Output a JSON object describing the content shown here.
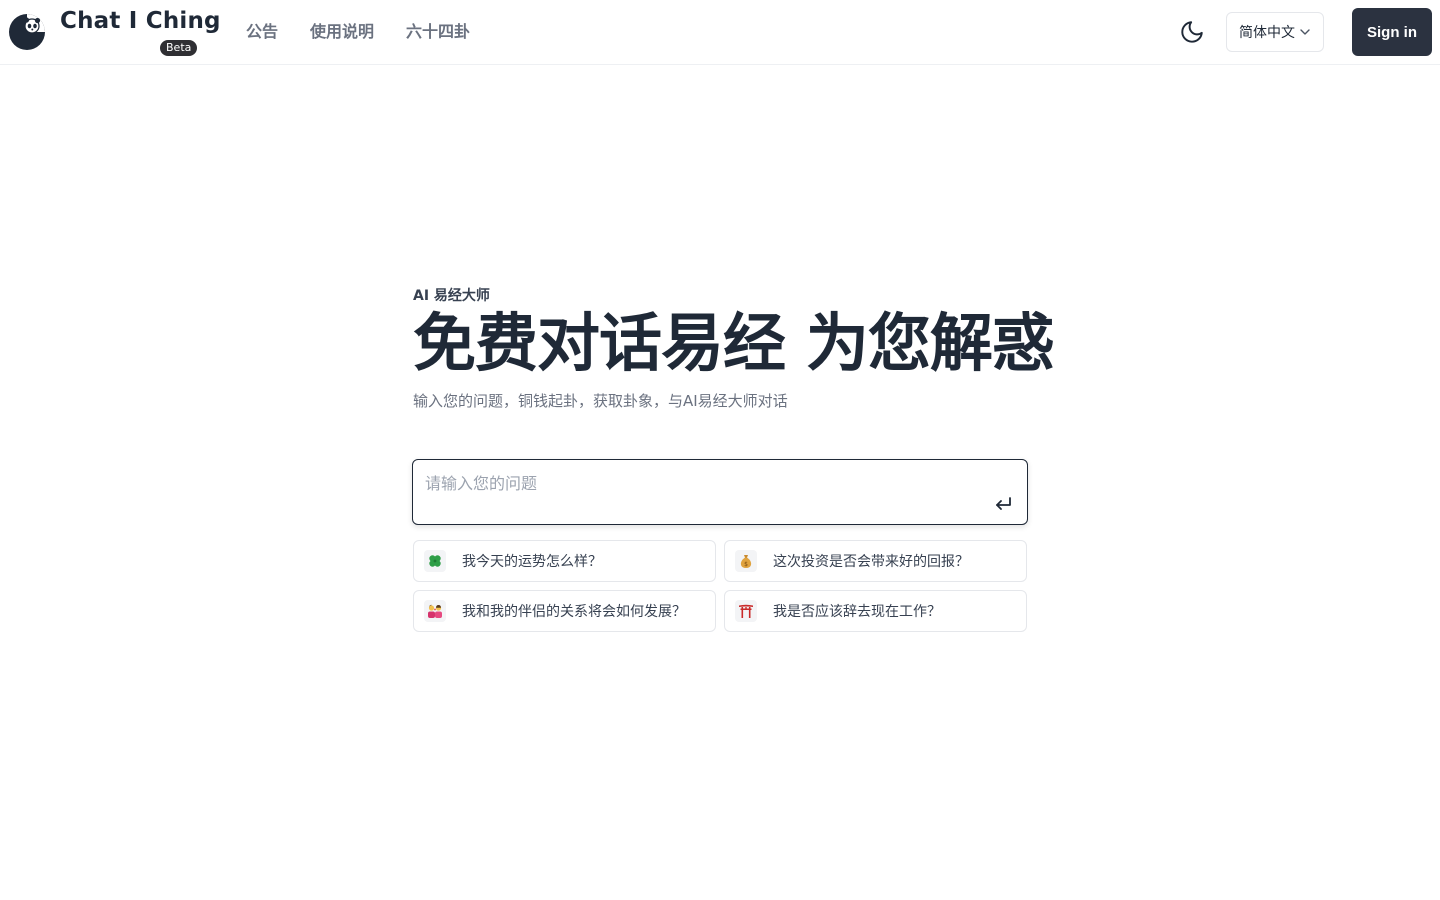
{
  "header": {
    "brand": "Chat I Ching",
    "badge": "Beta",
    "nav": [
      {
        "label": "公告"
      },
      {
        "label": "使用说明"
      },
      {
        "label": "六十四卦"
      }
    ],
    "language": "简体中文",
    "sign_in": "Sign in"
  },
  "hero": {
    "eyebrow": "AI 易经大师",
    "headline": "免费对话易经 为您解惑",
    "subtitle": "输入您的问题，铜钱起卦，获取卦象，与AI易经大师对话"
  },
  "input": {
    "placeholder": "请输入您的问题",
    "value": ""
  },
  "suggestions": [
    {
      "icon": "four-leaf-clover-icon",
      "text": "我今天的运势怎么样？"
    },
    {
      "icon": "money-bag-icon",
      "text": "这次投资是否会带来好的回报？"
    },
    {
      "icon": "couple-icon",
      "text": "我和我的伴侣的关系将会如何发展？"
    },
    {
      "icon": "torii-gate-icon",
      "text": "我是否应该辞去现在工作？"
    }
  ],
  "colors": {
    "primary_text": "#1f2937",
    "muted_text": "#6b7280",
    "button_bg": "#2b3240",
    "border": "#e5e7eb"
  }
}
